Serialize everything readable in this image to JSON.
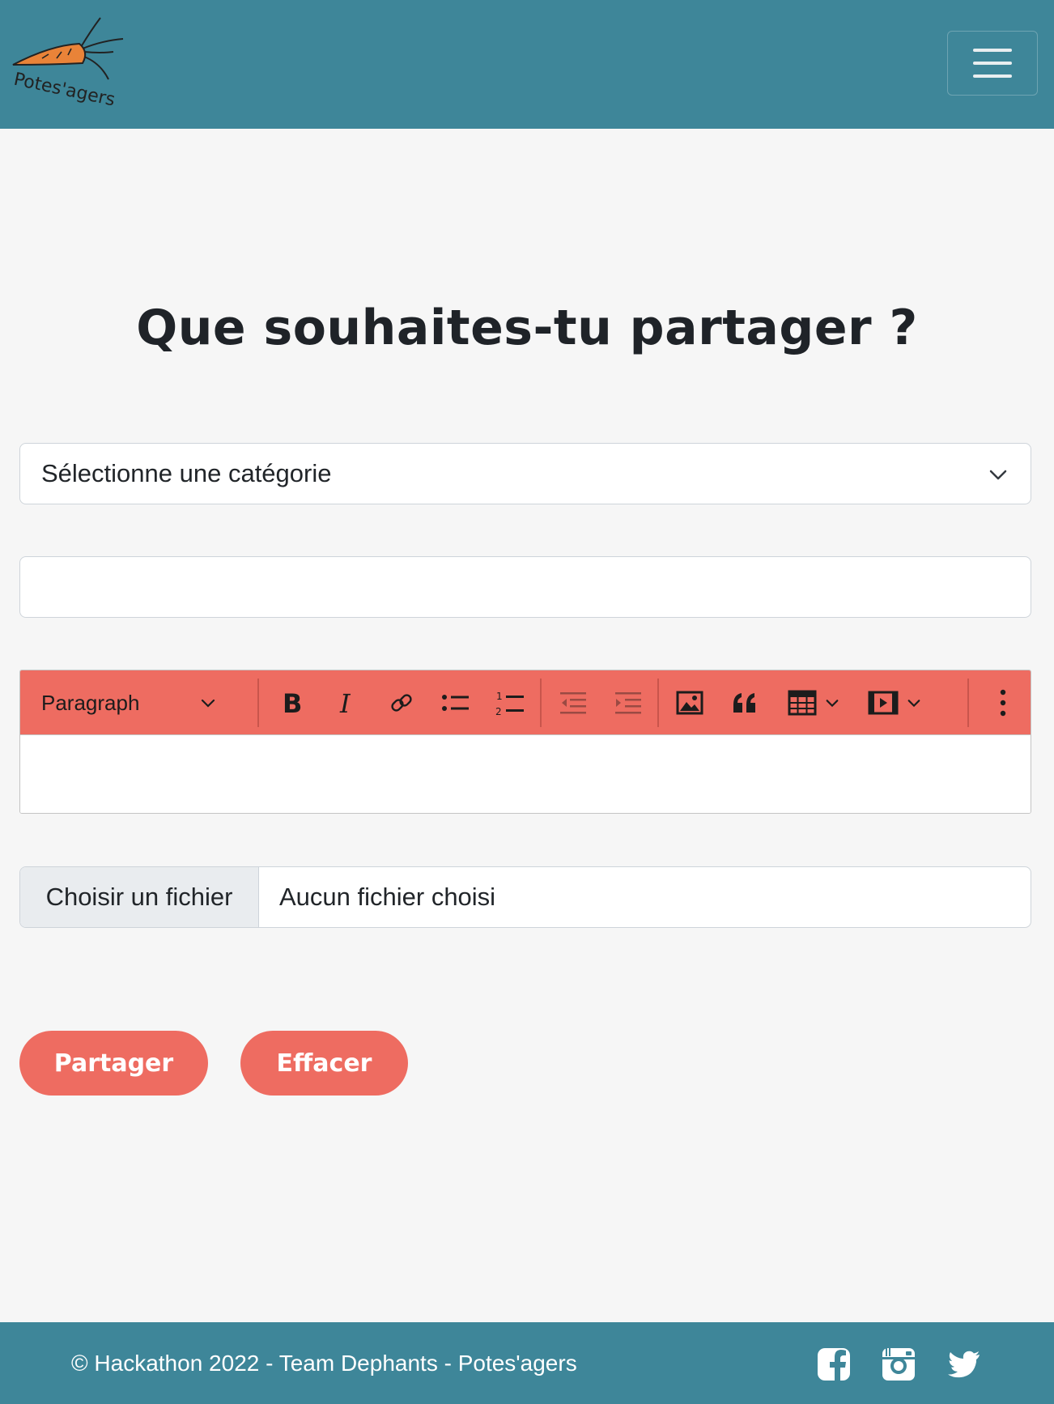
{
  "header": {
    "logo_text": "Potes'agers",
    "menu_toggle_label": ""
  },
  "main": {
    "title": "Que souhaites-tu partager ?",
    "category_select": {
      "selected": "Sélectionne une catégorie"
    },
    "title_input": {
      "value": "",
      "placeholder": ""
    },
    "editor": {
      "heading_dropdown": "Paragraph",
      "toolbar_icons": [
        "bold-icon",
        "italic-icon",
        "link-icon",
        "bulleted-list-icon",
        "numbered-list-icon",
        "outdent-icon",
        "indent-icon",
        "image-icon",
        "quote-icon",
        "table-icon",
        "media-icon",
        "more-icon"
      ],
      "content": ""
    },
    "file_input": {
      "button_label": "Choisir un fichier",
      "status": "Aucun fichier choisi"
    },
    "buttons": {
      "share": "Partager",
      "clear": "Effacer"
    }
  },
  "footer": {
    "text": "© Hackathon 2022 - Team Dephants - Potes'agers",
    "social_icons": [
      "facebook-icon",
      "instagram-icon",
      "twitter-icon"
    ]
  },
  "colors": {
    "header_bg": "#3e8699",
    "accent": "#ee6c61",
    "page_bg": "#f6f6f6"
  }
}
